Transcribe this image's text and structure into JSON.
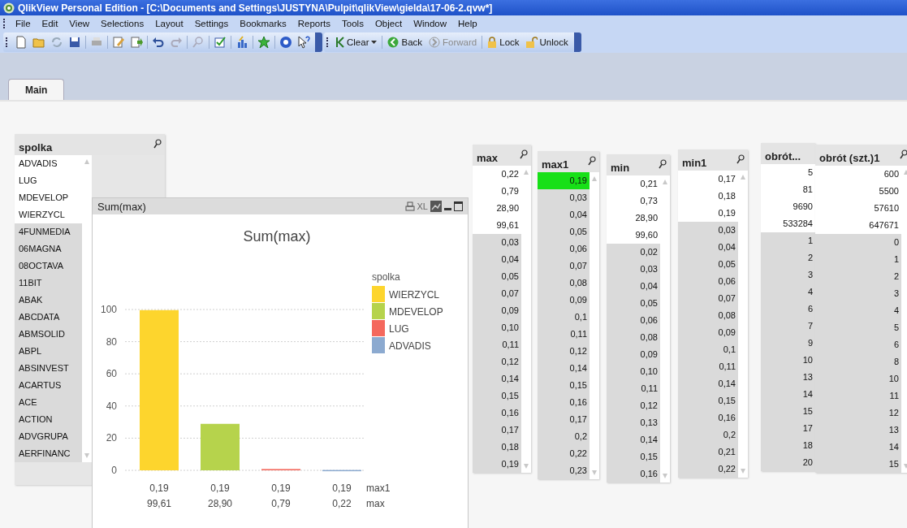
{
  "window": {
    "title": "QlikView Personal Edition - [C:\\Documents and Settings\\JUSTYNA\\Pulpit\\qlikView\\gielda\\17-06-2.qvw*]"
  },
  "menu": [
    "File",
    "Edit",
    "View",
    "Selections",
    "Layout",
    "Settings",
    "Bookmarks",
    "Reports",
    "Tools",
    "Object",
    "Window",
    "Help"
  ],
  "toolbar_buttons": [
    {
      "kind": "clear",
      "label": "Clear",
      "disabled": false
    },
    {
      "kind": "back",
      "label": "Back",
      "disabled": false
    },
    {
      "kind": "forward",
      "label": "Forward",
      "disabled": true
    },
    {
      "kind": "lock",
      "label": "Lock",
      "disabled": false
    },
    {
      "kind": "unlock",
      "label": "Unlock",
      "disabled": false
    }
  ],
  "tabs": [
    {
      "label": "Main",
      "selected": true
    }
  ],
  "listboxes": [
    {
      "title": "spolka",
      "values": [
        {
          "text": "ADVADIS",
          "selected": false,
          "excluded": false
        },
        {
          "text": "LUG",
          "selected": false,
          "excluded": false
        },
        {
          "text": "MDEVELOP",
          "selected": false,
          "excluded": false
        },
        {
          "text": "WIERZYCL",
          "selected": false,
          "excluded": false
        },
        {
          "text": "4FUNMEDIA",
          "selected": false,
          "excluded": true
        },
        {
          "text": "06MAGNA",
          "selected": false,
          "excluded": true
        },
        {
          "text": "08OCTAVA",
          "selected": false,
          "excluded": true
        },
        {
          "text": "11BIT",
          "selected": false,
          "excluded": true
        },
        {
          "text": "ABAK",
          "selected": false,
          "excluded": true
        },
        {
          "text": "ABCDATA",
          "selected": false,
          "excluded": true
        },
        {
          "text": "ABMSOLID",
          "selected": false,
          "excluded": true
        },
        {
          "text": "ABPL",
          "selected": false,
          "excluded": true
        },
        {
          "text": "ABSINVEST",
          "selected": false,
          "excluded": true
        },
        {
          "text": "ACARTUS",
          "selected": false,
          "excluded": true
        },
        {
          "text": "ACE",
          "selected": false,
          "excluded": true
        },
        {
          "text": "ACTION",
          "selected": false,
          "excluded": true
        },
        {
          "text": "ADVGRUPA",
          "selected": false,
          "excluded": true
        },
        {
          "text": "AERFINANC",
          "selected": false,
          "excluded": true
        }
      ]
    },
    {
      "title": "max",
      "values": [
        {
          "text": "0,22",
          "selected": false,
          "excluded": false
        },
        {
          "text": "0,79",
          "selected": false,
          "excluded": false
        },
        {
          "text": "28,90",
          "selected": false,
          "excluded": false
        },
        {
          "text": "99,61",
          "selected": false,
          "excluded": false
        },
        {
          "text": "0,03",
          "selected": false,
          "excluded": true
        },
        {
          "text": "0,04",
          "selected": false,
          "excluded": true
        },
        {
          "text": "0,05",
          "selected": false,
          "excluded": true
        },
        {
          "text": "0,07",
          "selected": false,
          "excluded": true
        },
        {
          "text": "0,09",
          "selected": false,
          "excluded": true
        },
        {
          "text": "0,10",
          "selected": false,
          "excluded": true
        },
        {
          "text": "0,11",
          "selected": false,
          "excluded": true
        },
        {
          "text": "0,12",
          "selected": false,
          "excluded": true
        },
        {
          "text": "0,14",
          "selected": false,
          "excluded": true
        },
        {
          "text": "0,15",
          "selected": false,
          "excluded": true
        },
        {
          "text": "0,16",
          "selected": false,
          "excluded": true
        },
        {
          "text": "0,17",
          "selected": false,
          "excluded": true
        },
        {
          "text": "0,18",
          "selected": false,
          "excluded": true
        },
        {
          "text": "0,19",
          "selected": false,
          "excluded": true
        }
      ]
    },
    {
      "title": "max1",
      "values": [
        {
          "text": "0,19",
          "selected": true,
          "excluded": false
        },
        {
          "text": "0,03",
          "selected": false,
          "excluded": true
        },
        {
          "text": "0,04",
          "selected": false,
          "excluded": true
        },
        {
          "text": "0,05",
          "selected": false,
          "excluded": true
        },
        {
          "text": "0,06",
          "selected": false,
          "excluded": true
        },
        {
          "text": "0,07",
          "selected": false,
          "excluded": true
        },
        {
          "text": "0,08",
          "selected": false,
          "excluded": true
        },
        {
          "text": "0,09",
          "selected": false,
          "excluded": true
        },
        {
          "text": "0,1",
          "selected": false,
          "excluded": true
        },
        {
          "text": "0,11",
          "selected": false,
          "excluded": true
        },
        {
          "text": "0,12",
          "selected": false,
          "excluded": true
        },
        {
          "text": "0,14",
          "selected": false,
          "excluded": true
        },
        {
          "text": "0,15",
          "selected": false,
          "excluded": true
        },
        {
          "text": "0,16",
          "selected": false,
          "excluded": true
        },
        {
          "text": "0,17",
          "selected": false,
          "excluded": true
        },
        {
          "text": "0,2",
          "selected": false,
          "excluded": true
        },
        {
          "text": "0,22",
          "selected": false,
          "excluded": true
        },
        {
          "text": "0,23",
          "selected": false,
          "excluded": true
        }
      ]
    },
    {
      "title": "min",
      "values": [
        {
          "text": "0,21",
          "selected": false,
          "excluded": false
        },
        {
          "text": "0,73",
          "selected": false,
          "excluded": false
        },
        {
          "text": "28,90",
          "selected": false,
          "excluded": false
        },
        {
          "text": "99,60",
          "selected": false,
          "excluded": false
        },
        {
          "text": "0,02",
          "selected": false,
          "excluded": true
        },
        {
          "text": "0,03",
          "selected": false,
          "excluded": true
        },
        {
          "text": "0,04",
          "selected": false,
          "excluded": true
        },
        {
          "text": "0,05",
          "selected": false,
          "excluded": true
        },
        {
          "text": "0,06",
          "selected": false,
          "excluded": true
        },
        {
          "text": "0,08",
          "selected": false,
          "excluded": true
        },
        {
          "text": "0,09",
          "selected": false,
          "excluded": true
        },
        {
          "text": "0,10",
          "selected": false,
          "excluded": true
        },
        {
          "text": "0,11",
          "selected": false,
          "excluded": true
        },
        {
          "text": "0,12",
          "selected": false,
          "excluded": true
        },
        {
          "text": "0,13",
          "selected": false,
          "excluded": true
        },
        {
          "text": "0,14",
          "selected": false,
          "excluded": true
        },
        {
          "text": "0,15",
          "selected": false,
          "excluded": true
        },
        {
          "text": "0,16",
          "selected": false,
          "excluded": true
        }
      ]
    },
    {
      "title": "min1",
      "values": [
        {
          "text": "0,17",
          "selected": false,
          "excluded": false
        },
        {
          "text": "0,18",
          "selected": false,
          "excluded": false
        },
        {
          "text": "0,19",
          "selected": false,
          "excluded": false
        },
        {
          "text": "0,03",
          "selected": false,
          "excluded": true
        },
        {
          "text": "0,04",
          "selected": false,
          "excluded": true
        },
        {
          "text": "0,05",
          "selected": false,
          "excluded": true
        },
        {
          "text": "0,06",
          "selected": false,
          "excluded": true
        },
        {
          "text": "0,07",
          "selected": false,
          "excluded": true
        },
        {
          "text": "0,08",
          "selected": false,
          "excluded": true
        },
        {
          "text": "0,09",
          "selected": false,
          "excluded": true
        },
        {
          "text": "0,1",
          "selected": false,
          "excluded": true
        },
        {
          "text": "0,11",
          "selected": false,
          "excluded": true
        },
        {
          "text": "0,14",
          "selected": false,
          "excluded": true
        },
        {
          "text": "0,15",
          "selected": false,
          "excluded": true
        },
        {
          "text": "0,16",
          "selected": false,
          "excluded": true
        },
        {
          "text": "0,2",
          "selected": false,
          "excluded": true
        },
        {
          "text": "0,21",
          "selected": false,
          "excluded": true
        },
        {
          "text": "0,22",
          "selected": false,
          "excluded": true
        }
      ]
    },
    {
      "title": "obrót...",
      "values": [
        {
          "text": "5",
          "selected": false,
          "excluded": false
        },
        {
          "text": "81",
          "selected": false,
          "excluded": false
        },
        {
          "text": "9690",
          "selected": false,
          "excluded": false
        },
        {
          "text": "533284",
          "selected": false,
          "excluded": false
        },
        {
          "text": "1",
          "selected": false,
          "excluded": true
        },
        {
          "text": "2",
          "selected": false,
          "excluded": true
        },
        {
          "text": "3",
          "selected": false,
          "excluded": true
        },
        {
          "text": "4",
          "selected": false,
          "excluded": true
        },
        {
          "text": "6",
          "selected": false,
          "excluded": true
        },
        {
          "text": "7",
          "selected": false,
          "excluded": true
        },
        {
          "text": "9",
          "selected": false,
          "excluded": true
        },
        {
          "text": "10",
          "selected": false,
          "excluded": true
        },
        {
          "text": "13",
          "selected": false,
          "excluded": true
        },
        {
          "text": "14",
          "selected": false,
          "excluded": true
        },
        {
          "text": "15",
          "selected": false,
          "excluded": true
        },
        {
          "text": "17",
          "selected": false,
          "excluded": true
        },
        {
          "text": "18",
          "selected": false,
          "excluded": true
        },
        {
          "text": "20",
          "selected": false,
          "excluded": true
        }
      ]
    },
    {
      "title": "obrót (szt.)1",
      "values": [
        {
          "text": "600",
          "selected": false,
          "excluded": false
        },
        {
          "text": "5500",
          "selected": false,
          "excluded": false
        },
        {
          "text": "57610",
          "selected": false,
          "excluded": false
        },
        {
          "text": "647671",
          "selected": false,
          "excluded": false
        },
        {
          "text": "0",
          "selected": false,
          "excluded": true
        },
        {
          "text": "1",
          "selected": false,
          "excluded": true
        },
        {
          "text": "2",
          "selected": false,
          "excluded": true
        },
        {
          "text": "3",
          "selected": false,
          "excluded": true
        },
        {
          "text": "4",
          "selected": false,
          "excluded": true
        },
        {
          "text": "5",
          "selected": false,
          "excluded": true
        },
        {
          "text": "6",
          "selected": false,
          "excluded": true
        },
        {
          "text": "8",
          "selected": false,
          "excluded": true
        },
        {
          "text": "10",
          "selected": false,
          "excluded": true
        },
        {
          "text": "11",
          "selected": false,
          "excluded": true
        },
        {
          "text": "12",
          "selected": false,
          "excluded": true
        },
        {
          "text": "13",
          "selected": false,
          "excluded": true
        },
        {
          "text": "14",
          "selected": false,
          "excluded": true
        },
        {
          "text": "15",
          "selected": false,
          "excluded": true
        }
      ]
    }
  ],
  "chart_object": {
    "caption": "Sum(max)",
    "export_label": "XL",
    "inner_dimension": "max1",
    "outer_dimension": "max",
    "inner_labels": [
      "0,19",
      "0,19",
      "0,19",
      "0,19"
    ],
    "chart_data": {
      "type": "bar",
      "title": "Sum(max)",
      "legend": {
        "title": "spolka"
      },
      "grid": true,
      "categories": [
        "99,61",
        "28,90",
        "0,79",
        "0,22"
      ],
      "stacked": true,
      "ylim": [
        0,
        100
      ],
      "yticks": [
        {
          "value": 0,
          "label": "0"
        },
        {
          "value": 20,
          "label": "20"
        },
        {
          "value": 40,
          "label": "40"
        },
        {
          "value": 60,
          "label": "60"
        },
        {
          "value": 80,
          "label": "80"
        },
        {
          "value": 100,
          "label": "100"
        }
      ],
      "series": [
        {
          "name": "WIERZYCL",
          "color": "#fdd52d",
          "values": [
            99.6,
            null,
            null,
            null
          ]
        },
        {
          "name": "MDEVELOP",
          "color": "#b6d34c",
          "values": [
            null,
            28.9,
            null,
            null
          ]
        },
        {
          "name": "LUG",
          "color": "#f4685d",
          "values": [
            null,
            null,
            0.8,
            null
          ]
        },
        {
          "name": "ADVADIS",
          "color": "#8caad0",
          "values": [
            null,
            null,
            null,
            0.2
          ]
        }
      ]
    }
  }
}
